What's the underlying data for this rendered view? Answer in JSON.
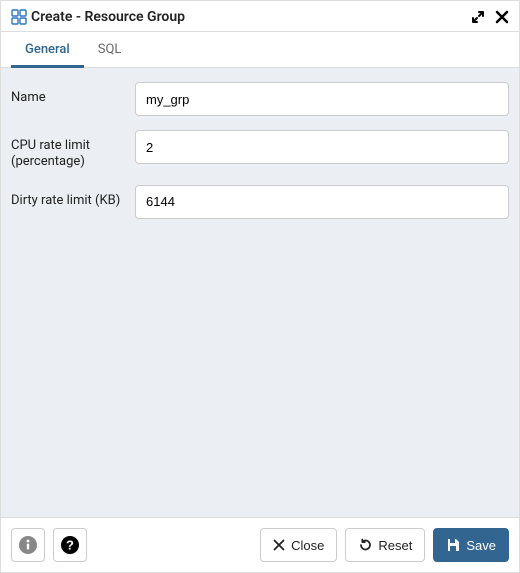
{
  "dialog": {
    "title": "Create - Resource Group"
  },
  "tabs": [
    {
      "label": "General",
      "active": true
    },
    {
      "label": "SQL",
      "active": false
    }
  ],
  "form": {
    "name": {
      "label": "Name",
      "value": "my_grp"
    },
    "cpu_rate_limit": {
      "label": "CPU rate limit (percentage)",
      "value": "2"
    },
    "dirty_rate_limit": {
      "label": "Dirty rate limit (KB)",
      "value": "6144"
    }
  },
  "footer": {
    "close_label": "Close",
    "reset_label": "Reset",
    "save_label": "Save"
  }
}
